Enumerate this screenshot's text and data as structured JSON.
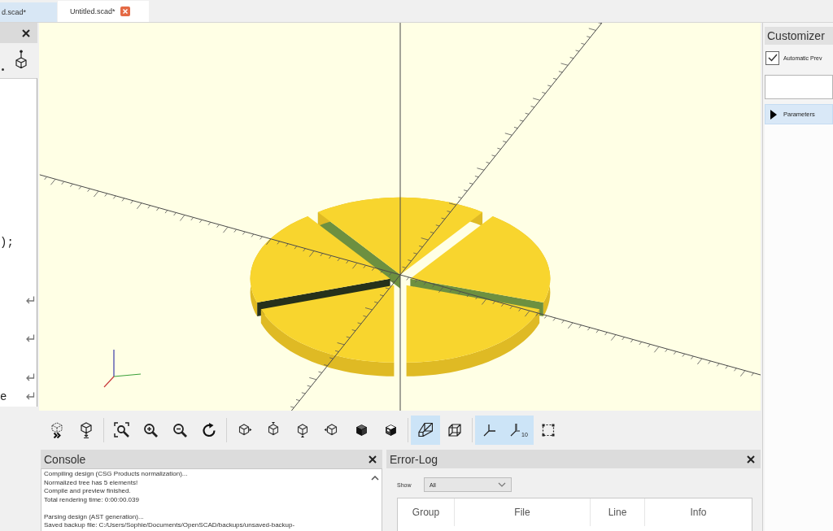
{
  "tabs": [
    {
      "label": "d.scad*",
      "selected": false
    },
    {
      "label": "Untitled.scad*",
      "selected": true
    }
  ],
  "editor": {
    "lines": [
      {
        "wrapped": false
      },
      {
        "wrapped": false
      },
      {
        "wrapped": false
      },
      {
        "wrapped": false
      },
      {
        "wrapped": false
      },
      {
        "wrapped": false
      },
      {
        "wrapped": false
      },
      {
        "wrapped": false
      },
      {
        "text": ");",
        "wrapped": false
      },
      {
        "wrapped": false
      },
      {
        "wrapped": false
      },
      {
        "wrapped": true
      },
      {
        "wrapped": false
      },
      {
        "wrapped": true
      },
      {
        "wrapped": false
      },
      {
        "wrapped": true
      },
      {
        "text": "e",
        "wrapped": true
      }
    ]
  },
  "view_toolbar": {
    "groups": [
      {
        "buttons": [
          {
            "kind": "preview",
            "on": false
          },
          {
            "kind": "render",
            "on": false
          }
        ]
      },
      {
        "buttons": [
          {
            "kind": "view_all",
            "on": false
          },
          {
            "kind": "zoom_in",
            "on": false
          },
          {
            "kind": "zoom_out",
            "on": false
          },
          {
            "kind": "reset_view",
            "on": false
          }
        ]
      },
      {
        "buttons": [
          {
            "kind": "view_right",
            "on": false
          },
          {
            "kind": "view_top",
            "on": false
          },
          {
            "kind": "view_bottom",
            "on": false
          },
          {
            "kind": "view_left",
            "on": false
          },
          {
            "kind": "view_front",
            "on": false
          },
          {
            "kind": "view_back",
            "on": false
          }
        ]
      },
      {
        "buttons": [
          {
            "kind": "perspective",
            "on": true
          },
          {
            "kind": "orthogonal",
            "on": false
          }
        ]
      },
      {
        "buttons": [
          {
            "kind": "show_axes",
            "on": true
          },
          {
            "kind": "show_scale",
            "on": true,
            "label": "10"
          },
          {
            "kind": "show_edges",
            "on": false
          }
        ]
      }
    ]
  },
  "console": {
    "title": "Console",
    "blocks": [
      {
        "lines": [
          "Compiling design (CSG Products normalization)...",
          "Normalized tree has 5 elements!",
          "Compile and preview finished.",
          "Total rendering time: 0:00:00.039"
        ]
      },
      {
        "lines": [
          "Parsing design (AST generation)...",
          "Saved backup file: C:/Users/Sophie/Documents/OpenSCAD/backups/unsaved-backup-"
        ]
      }
    ]
  },
  "error_log": {
    "title": "Error-Log",
    "filter": {
      "label": "Show",
      "value": "All"
    },
    "columns": [
      "Group",
      "File",
      "Line",
      "Info"
    ]
  },
  "customizer": {
    "title": "Customizer",
    "auto_preview": {
      "label": "Automatic Prev",
      "checked": true
    },
    "sections": [
      {
        "label": "Parameters",
        "expanded": false
      }
    ]
  }
}
